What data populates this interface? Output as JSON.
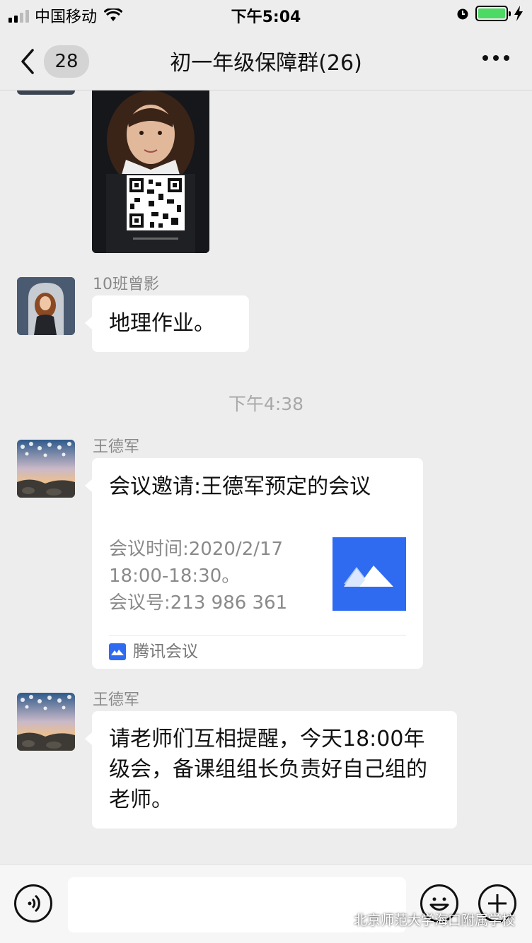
{
  "status_bar": {
    "carrier": "中国移动",
    "time": "下午5:04"
  },
  "nav": {
    "back_count": "28",
    "title": "初一年级保障群(26)"
  },
  "messages": [
    {
      "sender": "10班曾影",
      "text": "地理作业。"
    },
    {
      "time_separator": "下午4:38"
    },
    {
      "sender": "王德军",
      "card": {
        "title": "会议邀请:王德军预定的会议",
        "line1": "会议时间:2020/2/17",
        "line2": "18:00-18:30。",
        "line3": "会议号:213 986 361",
        "source": "腾讯会议"
      }
    },
    {
      "sender": "王德军",
      "text": "请老师们互相提醒，今天18:00年级会，备课组组长负责好自己组的老师。"
    }
  ],
  "watermark": "北京师范大学海口附属学校",
  "colors": {
    "tencent_meeting_blue": "#2f6bf0",
    "battery_green": "#4cd964"
  },
  "icons": [
    "signal-icon",
    "wifi-icon",
    "alarm-icon",
    "battery-icon",
    "charging-icon",
    "back-chevron-icon",
    "more-icon",
    "voice-icon",
    "emoji-icon",
    "add-icon",
    "tencent-meeting-icon",
    "wechat-icon"
  ]
}
